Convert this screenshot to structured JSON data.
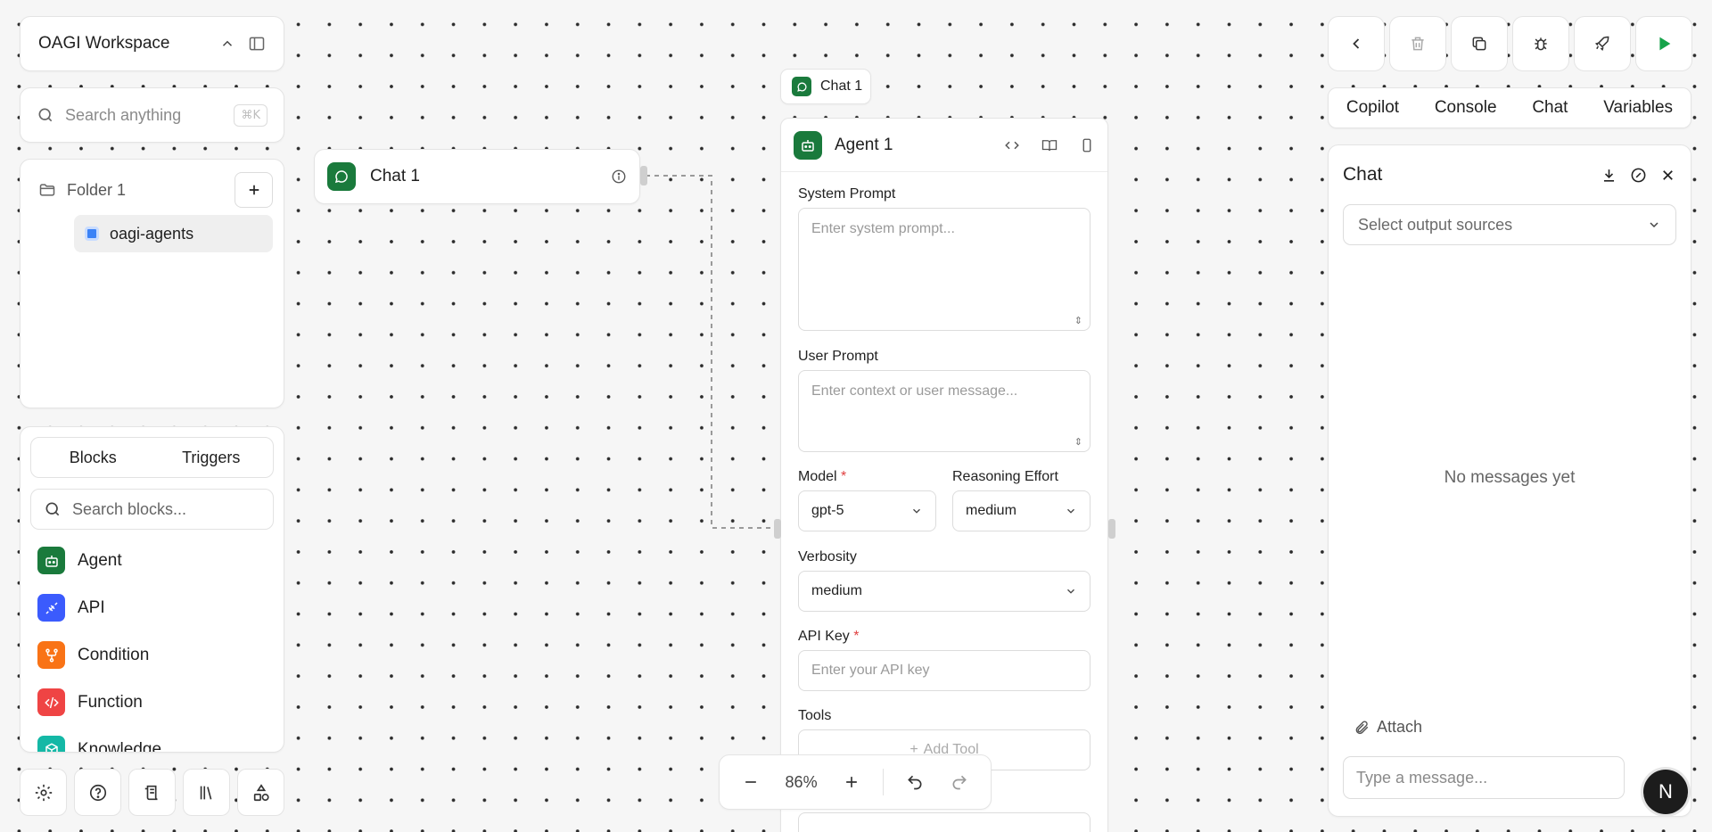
{
  "workspace": {
    "name": "OAGI Workspace"
  },
  "search": {
    "placeholder": "Search anything",
    "shortcut": "⌘K"
  },
  "folders": {
    "folder_name": "Folder 1",
    "workflow_name": "oagi-agents"
  },
  "blocks_panel": {
    "tabs": [
      "Blocks",
      "Triggers"
    ],
    "search_placeholder": "Search blocks...",
    "items": [
      {
        "label": "Agent",
        "icon": "robot-icon",
        "color": "#1a7a3c"
      },
      {
        "label": "API",
        "icon": "plug-icon",
        "color": "#3b5bfd"
      },
      {
        "label": "Condition",
        "icon": "branch-icon",
        "color": "#f97316"
      },
      {
        "label": "Function",
        "icon": "code-icon",
        "color": "#ef4444"
      },
      {
        "label": "Knowledge",
        "icon": "cube-icon",
        "color": "#14b8a6"
      }
    ]
  },
  "bottom_tools": [
    "settings-icon",
    "help-icon",
    "logs-icon",
    "library-icon",
    "shapes-icon"
  ],
  "canvas": {
    "chat_node": {
      "label": "Chat 1"
    },
    "chat_chip": {
      "label": "Chat 1"
    },
    "agent_node": {
      "label": "Agent 1",
      "system_prompt": {
        "label": "System Prompt",
        "placeholder": "Enter system prompt..."
      },
      "user_prompt": {
        "label": "User Prompt",
        "placeholder": "Enter context or user message..."
      },
      "model": {
        "label": "Model",
        "required": "*",
        "value": "gpt-5"
      },
      "reasoning": {
        "label": "Reasoning Effort",
        "value": "medium"
      },
      "verbosity": {
        "label": "Verbosity",
        "value": "medium"
      },
      "api_key": {
        "label": "API Key",
        "required": "*",
        "placeholder": "Enter your API key"
      },
      "tools": {
        "label": "Tools",
        "add_label": "Add Tool"
      }
    }
  },
  "zoom": {
    "level": "86%"
  },
  "right_panel": {
    "tabs": [
      "Copilot",
      "Console",
      "Chat",
      "Variables"
    ],
    "chat": {
      "title": "Chat",
      "output_placeholder": "Select output sources",
      "empty": "No messages yet",
      "attach_label": "Attach",
      "message_placeholder": "Type a message..."
    }
  },
  "user": {
    "avatar_letter": "N"
  },
  "colors": {
    "accent_green": "#1a7a3c",
    "run_green": "#16a34a"
  }
}
